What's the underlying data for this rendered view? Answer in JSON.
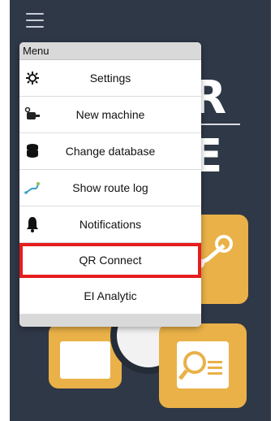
{
  "menu": {
    "header": "Menu",
    "items": [
      {
        "label": "Settings",
        "icon": "gear-icon"
      },
      {
        "label": "New machine",
        "icon": "machine-icon"
      },
      {
        "label": "Change database",
        "icon": "database-icon"
      },
      {
        "label": "Show route log",
        "icon": "route-icon"
      },
      {
        "label": "Notifications",
        "icon": "bell-icon"
      },
      {
        "label": "QR Connect",
        "icon": "",
        "highlighted": true
      },
      {
        "label": "EI Analytic",
        "icon": ""
      }
    ]
  },
  "background": {
    "logo_letters": [
      "R",
      "E"
    ]
  },
  "colors": {
    "screen_bg": "#2f3847",
    "tile": "#e9b148",
    "highlight": "#e61d1d"
  }
}
